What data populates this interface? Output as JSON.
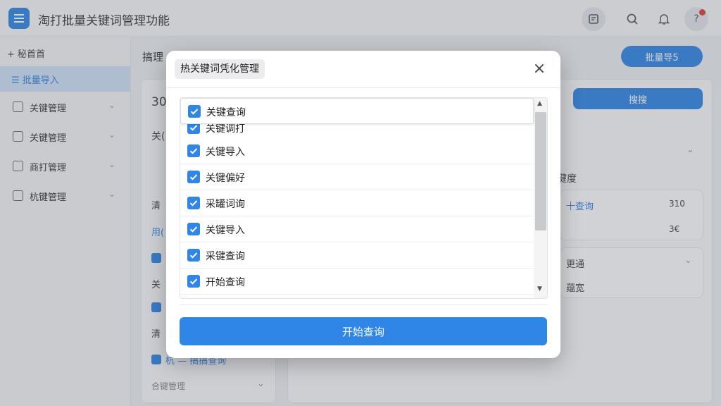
{
  "header": {
    "title": "淘打批量关键词管理功能"
  },
  "sidebar": {
    "home_label": "+ 秘首首",
    "active_label": "☰ 批量导入",
    "items": [
      {
        "label": "关键管理"
      },
      {
        "label": "关键管理"
      },
      {
        "label": "商打管理"
      },
      {
        "label": "杭键管理"
      }
    ]
  },
  "background": {
    "page_title": "搞理",
    "batch_button": "批量导5",
    "search_button": "搜搜",
    "count": "30",
    "panel_left": {
      "title": "关(",
      "sub_a": "清",
      "sub_b": "用(",
      "sub_c": "关",
      "sub_d": "清",
      "link": "杭 — 搞搞查询",
      "footer": "合键管理"
    },
    "panel_right": {
      "heading": "键度",
      "query_link": "十查询",
      "value_a": "310",
      "value_b": "3€",
      "row_a": "更通",
      "row_b": "蕴宽"
    }
  },
  "modal": {
    "title": "热关键词凭化管理",
    "close": "×",
    "items": [
      {
        "label": "关键查询",
        "checked": true
      },
      {
        "label": "关键调打",
        "checked": true
      },
      {
        "label": "关键导入",
        "checked": true
      },
      {
        "label": "关键偏好",
        "checked": true
      },
      {
        "label": "采罐词询",
        "checked": true
      },
      {
        "label": "关键导入",
        "checked": true
      },
      {
        "label": "采键查询",
        "checked": true
      },
      {
        "label": "开始查询",
        "checked": true
      }
    ],
    "start_button": "开始查询"
  },
  "colors": {
    "accent": "#2f86e6",
    "alert": "#e53935"
  },
  "icons": [
    "app-logo-icon",
    "note-icon",
    "search-icon",
    "bell-icon",
    "help-icon",
    "close-icon",
    "check-icon",
    "chevron-down-icon"
  ]
}
